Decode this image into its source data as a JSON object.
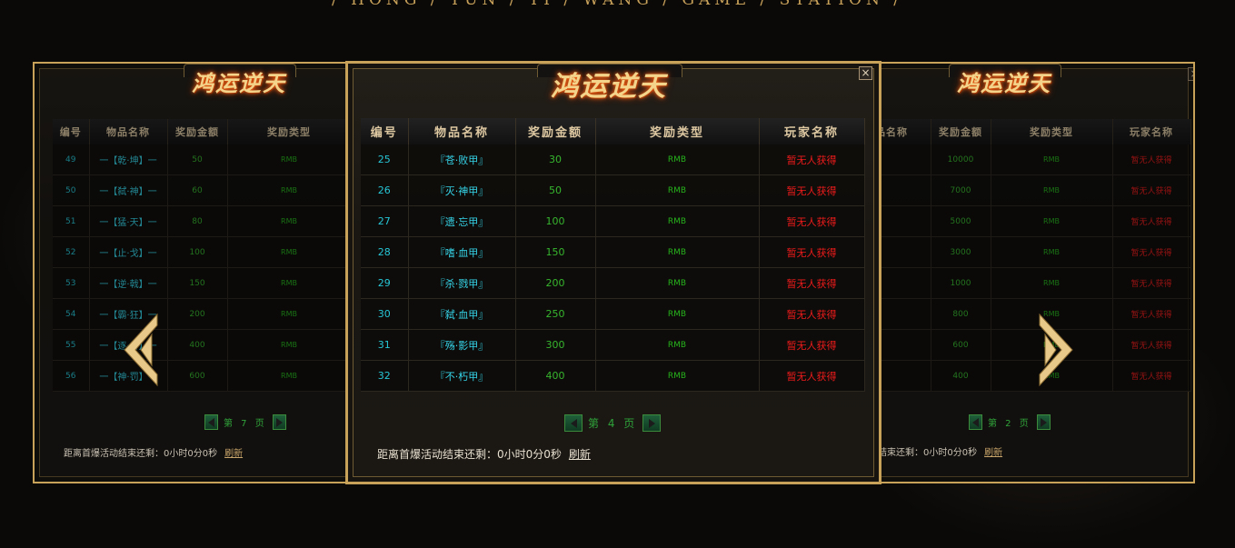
{
  "tagline": "/ HONG / YUN / TI / WANG / GAME / STATION /",
  "logo_text": "鸿运逆天",
  "headers": {
    "no": "编号",
    "item_name": "物品名称",
    "reward_amount": "奖励金额",
    "reward_type": "奖励类型",
    "player_name": "玩家名称"
  },
  "left_panel": {
    "rows": [
      {
        "no": "49",
        "name": "一【乾·坤】一",
        "amount": "50",
        "type": "RMB"
      },
      {
        "no": "50",
        "name": "一【弑·神】一",
        "amount": "60",
        "type": "RMB"
      },
      {
        "no": "51",
        "name": "一【猛·天】一",
        "amount": "80",
        "type": "RMB"
      },
      {
        "no": "52",
        "name": "一【止·戈】一",
        "amount": "100",
        "type": "RMB"
      },
      {
        "no": "53",
        "name": "一【逆·戟】一",
        "amount": "150",
        "type": "RMB"
      },
      {
        "no": "54",
        "name": "一【霸·狂】一",
        "amount": "200",
        "type": "RMB"
      },
      {
        "no": "55",
        "name": "一【逐·日】一",
        "amount": "400",
        "type": "RMB"
      },
      {
        "no": "56",
        "name": "一【神·罚】一",
        "amount": "600",
        "type": "RMB"
      }
    ],
    "page_label": "第 7 页",
    "countdown": "距离首爆活动结束还剩：0小时0分0秒",
    "refresh": "刷新"
  },
  "center_panel": {
    "rows": [
      {
        "no": "25",
        "name": "『苍·败甲』",
        "amount": "30",
        "type": "RMB",
        "player": "暂无人获得"
      },
      {
        "no": "26",
        "name": "『灭·神甲』",
        "amount": "50",
        "type": "RMB",
        "player": "暂无人获得"
      },
      {
        "no": "27",
        "name": "『遗·忘甲』",
        "amount": "100",
        "type": "RMB",
        "player": "暂无人获得"
      },
      {
        "no": "28",
        "name": "『嗜·血甲』",
        "amount": "150",
        "type": "RMB",
        "player": "暂无人获得"
      },
      {
        "no": "29",
        "name": "『杀·戮甲』",
        "amount": "200",
        "type": "RMB",
        "player": "暂无人获得"
      },
      {
        "no": "30",
        "name": "『弑·血甲』",
        "amount": "250",
        "type": "RMB",
        "player": "暂无人获得"
      },
      {
        "no": "31",
        "name": "『殇·影甲』",
        "amount": "300",
        "type": "RMB",
        "player": "暂无人获得"
      },
      {
        "no": "32",
        "name": "『不·朽甲』",
        "amount": "400",
        "type": "RMB",
        "player": "暂无人获得"
      }
    ],
    "page_label": "第 4 页",
    "countdown": "距离首爆活动结束还剩：0小时0分0秒",
    "refresh": "刷新",
    "close": "×"
  },
  "right_panel": {
    "headers_partial": "品名称",
    "rows": [
      {
        "amount": "10000",
        "type": "RMB",
        "player": "暂无人获得"
      },
      {
        "amount": "7000",
        "type": "RMB",
        "player": "暂无人获得"
      },
      {
        "amount": "5000",
        "type": "RMB",
        "player": "暂无人获得"
      },
      {
        "amount": "3000",
        "type": "RMB",
        "player": "暂无人获得"
      },
      {
        "amount": "1000",
        "type": "RMB",
        "player": "暂无人获得"
      },
      {
        "amount": "800",
        "type": "RMB",
        "player": "暂无人获得"
      },
      {
        "amount": "600",
        "type": "RMB",
        "player": "暂无人获得"
      },
      {
        "amount": "400",
        "type": "RMB",
        "player": "暂无人获得"
      }
    ],
    "page_label": "第 2 页",
    "countdown_partial": "结束还剩：0小时0分0秒",
    "refresh": "刷新"
  },
  "colors": {
    "gold_frame": "#c9a25a",
    "item_cyan": "#35d6ea",
    "amount_green": "#36b62e",
    "player_red": "#ee1b1b",
    "pager_green": "#2fa33a"
  }
}
